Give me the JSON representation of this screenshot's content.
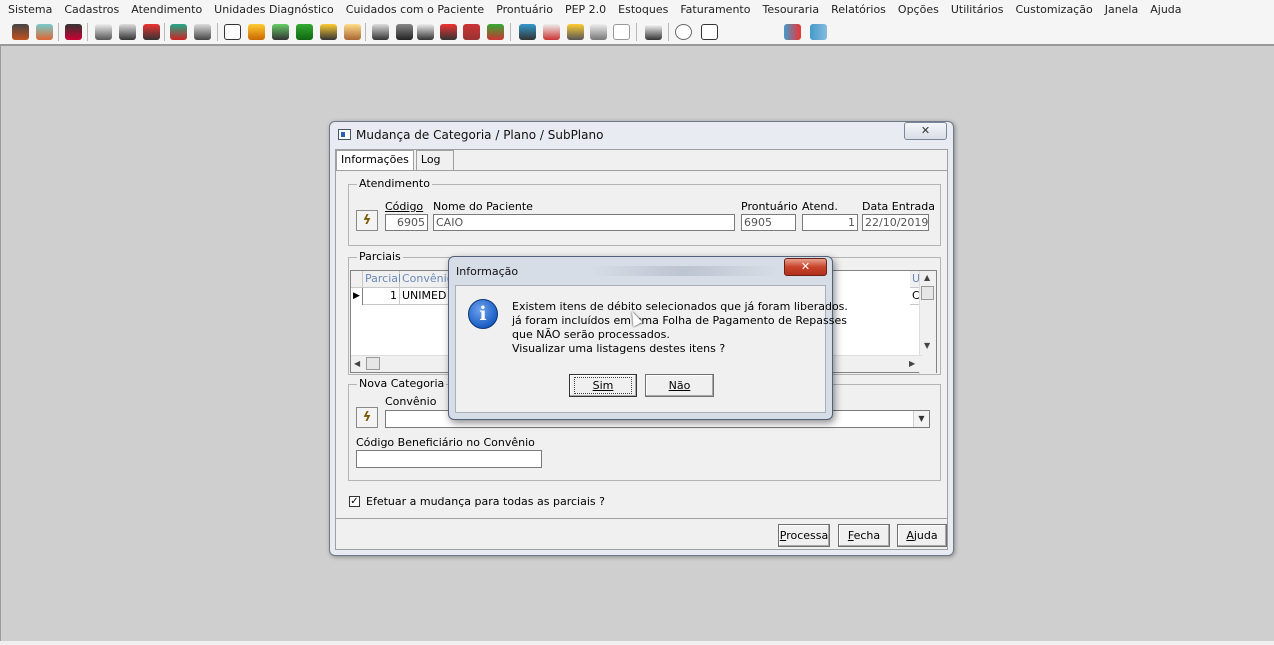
{
  "menubar": {
    "items": [
      "Sistema",
      "Cadastros",
      "Atendimento",
      "Unidades Diagnóstico",
      "Cuidados com o Paciente",
      "Prontuário",
      "PEP 2.0",
      "Estoques",
      "Faturamento",
      "Tesouraria",
      "Relatórios",
      "Opções",
      "Utilitários",
      "Customização",
      "Janela",
      "Ajuda"
    ]
  },
  "toolbar": {
    "icons": [
      "toolbar-icon-1",
      "toolbar-icon-2",
      "toolbar-icon-3",
      "toolbar-icon-4",
      "toolbar-icon-5",
      "toolbar-icon-6",
      "toolbar-icon-7",
      "toolbar-icon-8",
      "toolbar-icon-9",
      "toolbar-icon-10",
      "toolbar-icon-11",
      "toolbar-icon-12",
      "toolbar-icon-13",
      "toolbar-icon-14",
      "toolbar-icon-15",
      "toolbar-icon-16",
      "toolbar-icon-17",
      "toolbar-icon-18",
      "toolbar-icon-19",
      "toolbar-icon-20",
      "toolbar-icon-21",
      "toolbar-icon-22",
      "toolbar-icon-23",
      "toolbar-icon-24",
      "toolbar-icon-25",
      "toolbar-icon-26",
      "toolbar-icon-27",
      "toolbar-icon-28"
    ]
  },
  "window": {
    "title": "Mudança de Categoria / Plano / SubPlano",
    "close_glyph": "✕",
    "tabs": [
      "Informações",
      "Log"
    ],
    "atendimento": {
      "legend": "Atendimento",
      "codigo_label": "Código",
      "codigo_value": "6905",
      "nome_label": "Nome do Paciente",
      "nome_value": "CAIO",
      "prontuario_label": "Prontuário",
      "prontuario_value": "6905",
      "atend_label": "Atend.",
      "atend_value": "1",
      "data_label": "Data Entrada",
      "data_value": "22/10/2019"
    },
    "parciais": {
      "legend": "Parciais",
      "columns": [
        "Parcial",
        "Convênio",
        "U"
      ],
      "rows": [
        {
          "parcial": "1",
          "convenio": "UNIMED",
          "last": "C"
        }
      ],
      "indicator": "▶"
    },
    "nova_categoria": {
      "legend": "Nova Categoria",
      "convenio_label": "Convênio",
      "beneficiario_label": "Código Beneficiário no Convênio"
    },
    "checkbox_label": "Efetuar a mudança para todas as parciais ?",
    "checkbox_checked": true,
    "buttons": {
      "processa": "Processa",
      "fecha": "Fecha",
      "ajuda": "Ajuda"
    }
  },
  "message_box": {
    "title": "Informação",
    "close_glyph": "✕",
    "icon": "info-icon",
    "lines": [
      "Existem itens de débito selecionados que já foram liberados.",
      "já foram incluídos em uma Folha de Pagamento de Repasses",
      "que NÃO serão processados.",
      "Visualizar uma listagens destes itens ?"
    ],
    "yes_label": "Sim",
    "no_label": "Não"
  },
  "colors": {
    "desktop": "#cfcfcf",
    "close_button": "#c9432b",
    "info_icon": "#1b5fc5"
  }
}
